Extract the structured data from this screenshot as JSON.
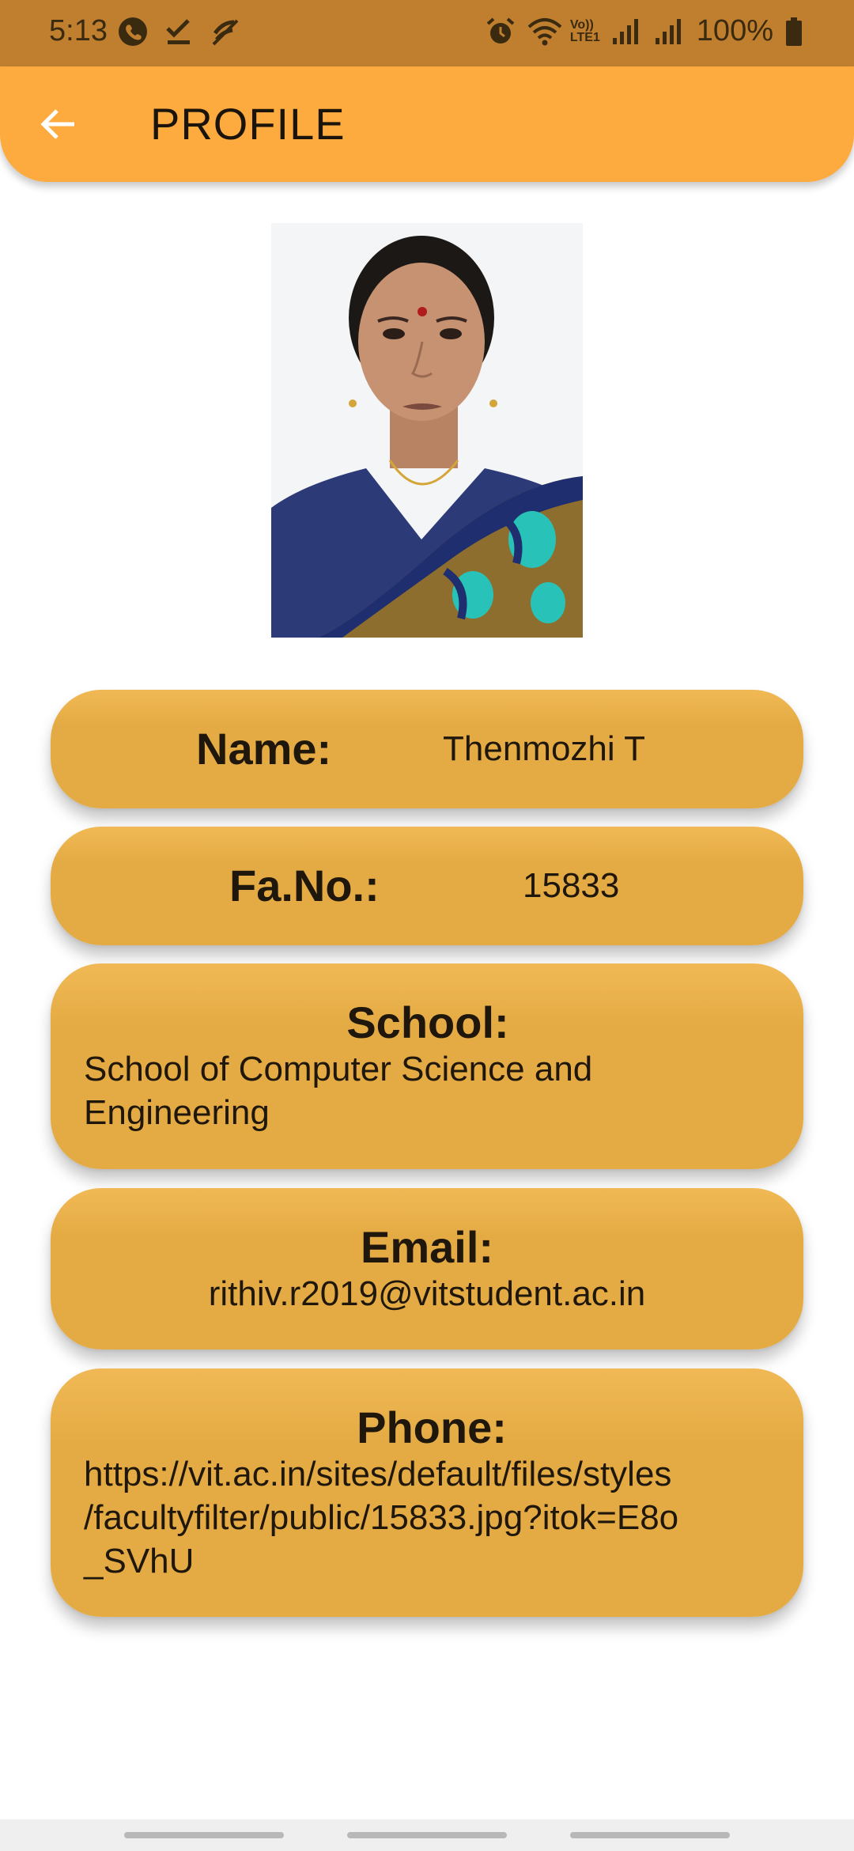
{
  "status_bar": {
    "time": "5:13",
    "battery": "100%",
    "left_icons": [
      "phone-icon",
      "check-icon",
      "mute-icon"
    ],
    "right_icons": [
      "alarm-icon",
      "wifi-icon",
      "volte-icon",
      "signal-icon",
      "signal-icon",
      "battery-icon"
    ],
    "volte_label": "Vo))",
    "lte_label": "LTE1"
  },
  "app_bar": {
    "title": "PROFILE",
    "back_icon": "arrow-left-icon"
  },
  "profile": {
    "photo_icon": "faculty-photo",
    "name_label": "Name:",
    "name_value": "Thenmozhi T",
    "fano_label": "Fa.No.:",
    "fano_value": "15833",
    "school_label": "School:",
    "school_value": "School of Computer Science and Engineering",
    "email_label": "Email:",
    "email_value": "rithiv.r2019@vitstudent.ac.in",
    "phone_label": "Phone:",
    "phone_value_line1": "https://vit.ac.in/sites/default/files/styles",
    "phone_value_line2": "/facultyfilter/public/15833.jpg?itok=E8o",
    "phone_value_line3": "_SVhU"
  },
  "colors": {
    "status_bar": "#c07f2f",
    "app_bar": "#fdab3f",
    "card": "#e4ab44"
  }
}
